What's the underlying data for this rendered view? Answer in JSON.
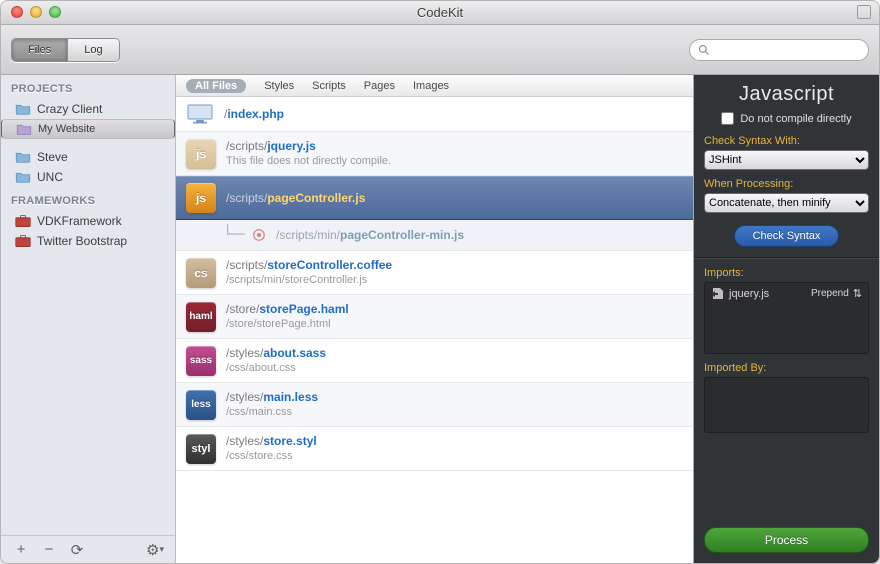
{
  "window": {
    "title": "CodeKit"
  },
  "toolbar": {
    "tabs": [
      "Files",
      "Log"
    ],
    "active": 0,
    "search_placeholder": ""
  },
  "sidebar": {
    "projects_header": "PROJECTS",
    "projects": [
      {
        "label": "Crazy Client"
      },
      {
        "label": "My Website",
        "selected": true
      },
      {
        "label": "Steve"
      },
      {
        "label": "UNC"
      }
    ],
    "frameworks_header": "FRAMEWORKS",
    "frameworks": [
      {
        "label": "VDKFramework"
      },
      {
        "label": "Twitter Bootstrap"
      }
    ]
  },
  "filters": {
    "items": [
      "All Files",
      "Styles",
      "Scripts",
      "Pages",
      "Images"
    ],
    "active": 0
  },
  "files": [
    {
      "type": "php",
      "badge": "",
      "dir": "/",
      "name": "index.php"
    },
    {
      "type": "js",
      "badge": "js",
      "dir": "/scripts/",
      "name": "jquery.js",
      "sub": "This file does not directly compile.",
      "muted": true
    },
    {
      "type": "js",
      "badge": "js",
      "dir": "/scripts/",
      "name": "pageController.js",
      "selected": true
    },
    {
      "type": "child",
      "dir": "/scripts/min/",
      "name": "pageController-min.js"
    },
    {
      "type": "cs",
      "badge": "cs",
      "dir": "/scripts/",
      "name": "storeController.coffee",
      "sub": "/scripts/min/storeController.js"
    },
    {
      "type": "haml",
      "badge": "haml",
      "dir": "/store/",
      "name": "storePage.haml",
      "sub": "/store/storePage.html"
    },
    {
      "type": "sass",
      "badge": "sass",
      "dir": "/styles/",
      "name": "about.sass",
      "sub": "/css/about.css"
    },
    {
      "type": "less",
      "badge": "less",
      "dir": "/styles/",
      "name": "main.less",
      "sub": "/css/main.css"
    },
    {
      "type": "styl",
      "badge": "styl",
      "dir": "/styles/",
      "name": "store.styl",
      "sub": "/css/store.css"
    }
  ],
  "inspector": {
    "title": "Javascript",
    "compile_direct_label": "Do not compile directly",
    "compile_direct_checked": false,
    "syntax_label": "Check Syntax With:",
    "syntax_options": [
      "JSHint"
    ],
    "processing_label": "When Processing:",
    "processing_options": [
      "Concatenate, then minify"
    ],
    "check_syntax_btn": "Check Syntax",
    "imports_label": "Imports:",
    "imports": [
      {
        "name": "jquery.js",
        "mode": "Prepend"
      }
    ],
    "imported_by_label": "Imported By:",
    "process_btn": "Process"
  }
}
